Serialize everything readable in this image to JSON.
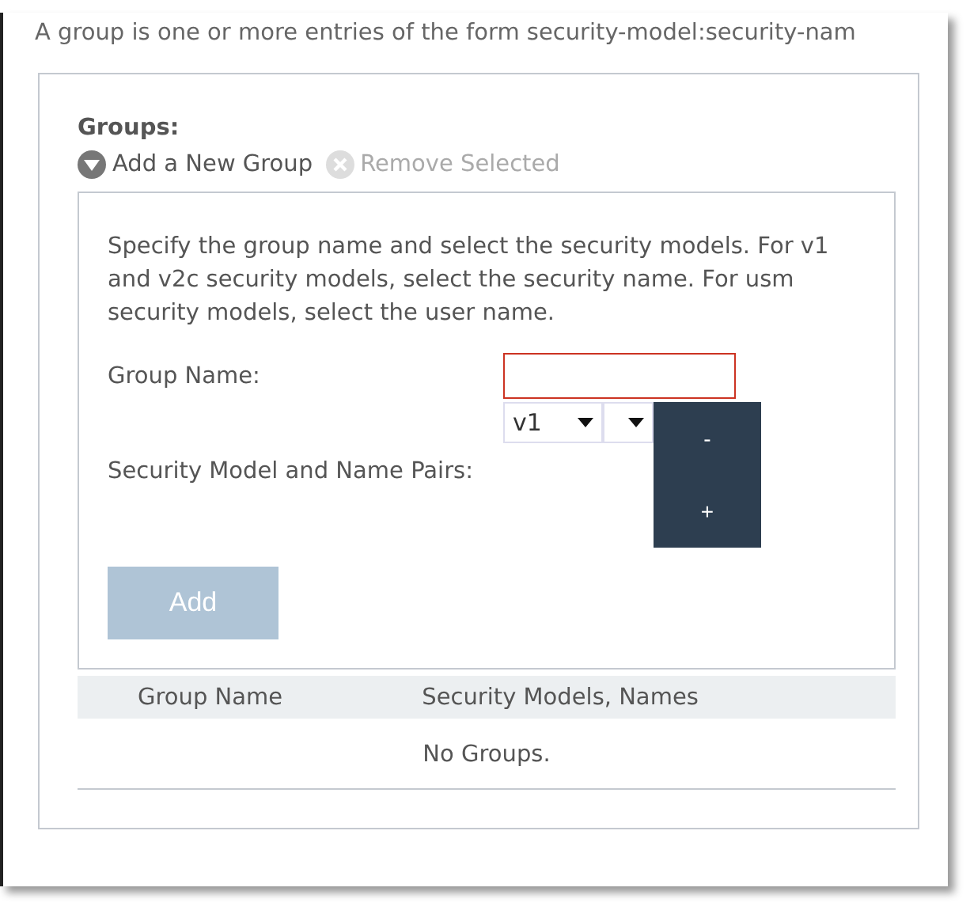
{
  "intro": "A group is one or more entries of the form security-model:security-nam",
  "groups": {
    "title": "Groups:",
    "actions": [
      {
        "kind": "add",
        "label": "Add a New Group",
        "disabled": false
      },
      {
        "kind": "remove",
        "label": "Remove Selected",
        "disabled": true
      }
    ],
    "form": {
      "description": "Specify the group name and select the security models. For v1 and v2c security models, select the security name. For usm security models, select the user name.",
      "group_name_label": "Group Name:",
      "group_name_invalid": true,
      "pairs_label": "Security Model and Name Pairs:",
      "model_value": "v1",
      "minus": "-",
      "plus": "+",
      "add_button": "Add",
      "add_disabled": true
    },
    "table": {
      "columns": [
        "Group Name",
        "Security Models, Names"
      ],
      "empty": "No Groups."
    }
  }
}
